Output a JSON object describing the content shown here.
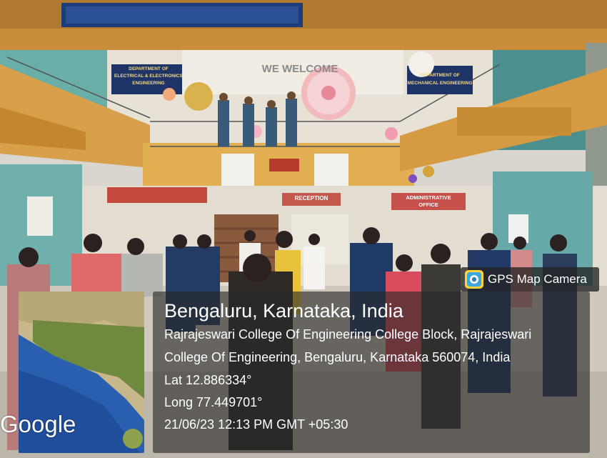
{
  "gps_badge": {
    "label": "GPS Map Camera",
    "icon": "gps-camera-icon"
  },
  "map": {
    "logo": "Google"
  },
  "location": {
    "title": "Bengaluru, Karnataka, India",
    "address_line1": "Rajrajeswari College Of Engineering College Block, Rajrajeswari",
    "address_line2": "College Of Engineering, Bengaluru, Karnataka 560074, India",
    "latitude": "Lat 12.886334°",
    "longitude": "Long 77.449701°",
    "timestamp": "21/06/23 12:13 PM GMT +05:30"
  },
  "scene_signs": {
    "dept_eee": [
      "DEPARTMENT OF",
      "ELECTRICAL & ELECTRONICS",
      "ENGINEERING"
    ],
    "dept_mech": [
      "DEPARTMENT OF",
      "MECHANICAL ENGINEERING"
    ],
    "banner": "WE WELCOME",
    "reception": "RECEPTION",
    "admin_office": [
      "ADMINISTRATIVE",
      "OFFICE"
    ]
  },
  "colors": {
    "panel": "#282828",
    "wall_orange": "#d79a3a",
    "wall_teal": "#5fa8a6",
    "sign_navy": "#1e3366"
  }
}
